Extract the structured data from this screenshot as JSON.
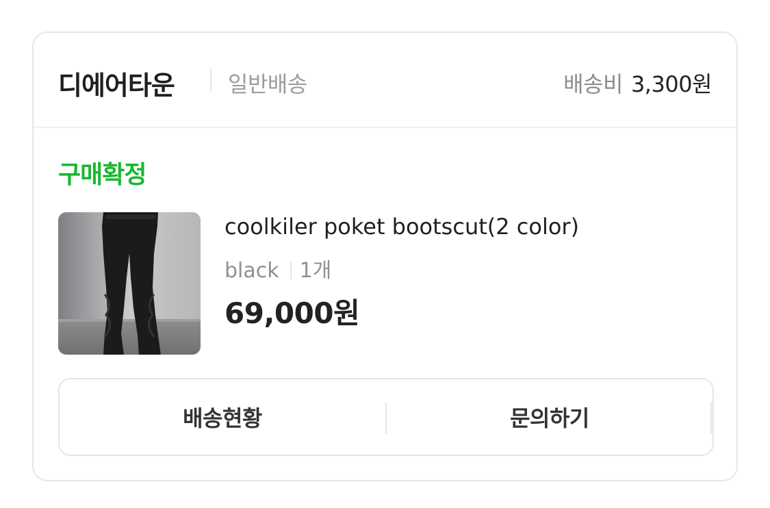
{
  "header": {
    "seller_name": "디에어타운",
    "shipping_type": "일반배송",
    "shipping_fee_label": "배송비",
    "shipping_fee_value": "3,300원"
  },
  "order": {
    "status": "구매확정",
    "status_color": "#16b82e"
  },
  "product": {
    "name": "coolkiler poket bootscut(2 color)",
    "option": "black",
    "quantity": "1개",
    "price": "69,000원",
    "image_icon": "product-photo-black-bootcut-pants"
  },
  "actions": {
    "track_delivery": "배송현황",
    "inquiry": "문의하기"
  }
}
